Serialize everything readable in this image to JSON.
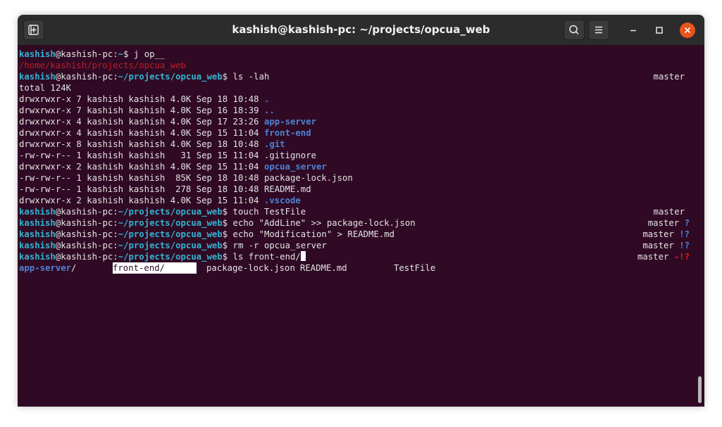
{
  "window": {
    "title": "kashish@kashish-pc: ~/projects/opcua_web"
  },
  "prompt": {
    "user": "kashish",
    "host_sep": "@kashish-pc:"
  },
  "lines": {
    "l1": {
      "path": "~",
      "cmd": "$ j op__"
    },
    "l2": {
      "text": "/home/kashish/projects/opcua_web"
    },
    "l3": {
      "path": "~/projects/opcua_web",
      "cmd": "$ ls -lah",
      "git": "master"
    },
    "l4": {
      "text": "total 124K"
    },
    "ls": [
      {
        "meta": "drwxrwxr-x 7 kashish kashish 4.0K Sep 18 10:48 ",
        "name": "."
      },
      {
        "meta": "drwxrwxr-x 7 kashish kashish 4.0K Sep 16 18:39 ",
        "name": ".."
      },
      {
        "meta": "drwxrwxr-x 4 kashish kashish 4.0K Sep 17 23:26 ",
        "name": "app-server"
      },
      {
        "meta": "drwxrwxr-x 4 kashish kashish 4.0K Sep 15 11:04 ",
        "name": "front-end"
      },
      {
        "meta": "drwxrwxr-x 8 kashish kashish 4.0K Sep 18 10:48 ",
        "name": ".git"
      },
      {
        "meta": "-rw-rw-r-- 1 kashish kashish   31 Sep 15 11:04 ",
        "name": ".gitignore"
      },
      {
        "meta": "drwxrwxr-x 2 kashish kashish 4.0K Sep 15 11:04 ",
        "name": "opcua_server"
      },
      {
        "meta": "-rw-rw-r-- 1 kashish kashish  85K Sep 18 10:48 ",
        "name": "package-lock.json"
      },
      {
        "meta": "-rw-rw-r-- 1 kashish kashish  278 Sep 18 10:48 ",
        "name": "README.md"
      },
      {
        "meta": "drwxrwxr-x 2 kashish kashish 4.0K Sep 15 11:04 ",
        "name": ".vscode"
      }
    ],
    "l15": {
      "path": "~/projects/opcua_web",
      "cmd": "$ touch TestFile",
      "git": "master",
      "flag": ""
    },
    "l16": {
      "path": "~/projects/opcua_web",
      "cmd": "$ echo \"AddLine\" >> package-lock.json",
      "git": "master ",
      "flag": "?"
    },
    "l17": {
      "path": "~/projects/opcua_web",
      "cmd": "$ echo \"Modification\" > README.md",
      "git": "master ",
      "flag": "!?"
    },
    "l18": {
      "path": "~/projects/opcua_web",
      "cmd": "$ rm -r opcua_server",
      "git": "master ",
      "flag": "!?"
    },
    "l19": {
      "path": "~/projects/opcua_web",
      "cmd": "$ ls front-end/",
      "git": "master ",
      "flag": "-!?"
    },
    "completion": {
      "c1": "app-server",
      "c1_suffix": "/",
      "c2": "front-end/",
      "c3": "package-lock.json",
      "c4": "README.md",
      "c5": "TestFile"
    }
  },
  "colors": {
    "background": "#300a24",
    "prompt": "#33b3cf",
    "directory": "#4d83d6",
    "error": "#c01c28"
  },
  "icons": {
    "new_tab": "new-tab-icon",
    "search": "search-icon",
    "menu": "hamburger-menu-icon",
    "minimize": "minimize-icon",
    "maximize": "maximize-icon",
    "close": "close-icon"
  }
}
